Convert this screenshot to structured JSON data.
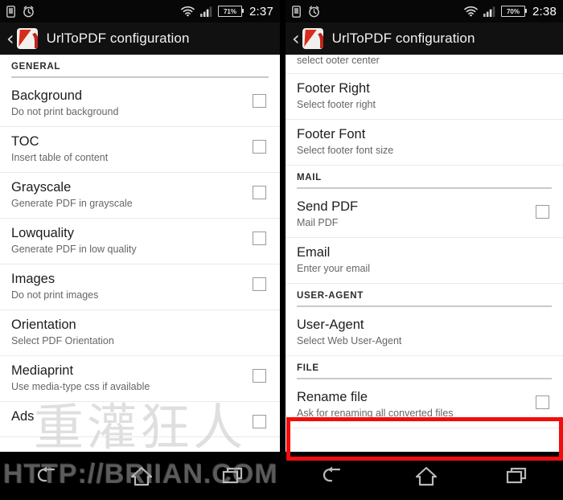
{
  "left": {
    "statusbar": {
      "icons": [
        "sim-card-icon",
        "alarm-clock-icon",
        "wifi-icon",
        "signal-icon"
      ],
      "battery": "71%",
      "time": "2:37"
    },
    "titlebar": {
      "back": "‹",
      "app_icon": "pdf-app-icon",
      "title": "UrlToPDF configuration"
    },
    "sections": [
      {
        "label": "GENERAL",
        "rows": [
          {
            "title": "Background",
            "sub": "Do not print background",
            "checkbox": true
          },
          {
            "title": "TOC",
            "sub": "Insert table of content",
            "checkbox": true
          },
          {
            "title": "Grayscale",
            "sub": "Generate PDF in grayscale",
            "checkbox": true
          },
          {
            "title": "Lowquality",
            "sub": "Generate PDF in low quality",
            "checkbox": true
          },
          {
            "title": "Images",
            "sub": "Do not print images",
            "checkbox": true
          },
          {
            "title": "Orientation",
            "sub": "Select PDF Orientation",
            "checkbox": false
          },
          {
            "title": "Mediaprint",
            "sub": "Use media-type css if available",
            "checkbox": true
          },
          {
            "title": "Ads",
            "sub": "",
            "checkbox": true
          }
        ]
      }
    ]
  },
  "right": {
    "statusbar": {
      "icons": [
        "sim-card-icon",
        "alarm-clock-icon",
        "wifi-icon",
        "signal-icon"
      ],
      "battery": "70%",
      "time": "2:38"
    },
    "titlebar": {
      "back": "‹",
      "app_icon": "pdf-app-icon",
      "title": "UrlToPDF configuration"
    },
    "cut_row_sub": "select ooter center",
    "rows_top": [
      {
        "title": "Footer Right",
        "sub": "Select footer right",
        "checkbox": false
      },
      {
        "title": "Footer Font",
        "sub": "Select footer font size",
        "checkbox": false
      }
    ],
    "sections": [
      {
        "label": "MAIL",
        "rows": [
          {
            "title": "Send PDF",
            "sub": "Mail PDF",
            "checkbox": true
          },
          {
            "title": "Email",
            "sub": "Enter your email",
            "checkbox": false
          }
        ]
      },
      {
        "label": "USER-AGENT",
        "rows": [
          {
            "title": "User-Agent",
            "sub": "Select Web User-Agent",
            "checkbox": false
          }
        ]
      },
      {
        "label": "FILE",
        "rows": [
          {
            "title": "Rename file",
            "sub": "Ask for renaming all converted files",
            "checkbox": true
          }
        ]
      }
    ],
    "highlight_color": "#f20d0d"
  },
  "navbar": {
    "back": "back-icon",
    "home": "home-icon",
    "recents": "recents-icon"
  },
  "watermark": {
    "cn": "重灌狂人",
    "url": "HTTP://BRIIAN.COM"
  }
}
